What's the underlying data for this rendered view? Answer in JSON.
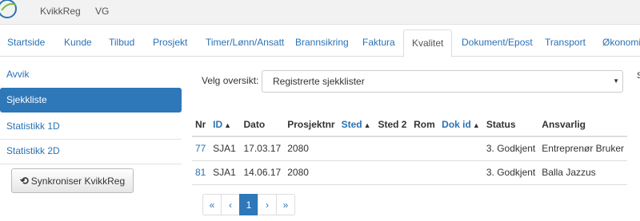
{
  "header": {
    "brand": "KvikkReg",
    "user": "VG"
  },
  "tabs": [
    {
      "label": "Startside"
    },
    {
      "label": "Kunde"
    },
    {
      "label": "Tilbud"
    },
    {
      "label": "Prosjekt"
    },
    {
      "label": "Timer/Lønn/Ansatt"
    },
    {
      "label": "Brannsikring"
    },
    {
      "label": "Faktura"
    },
    {
      "label": "Kvalitet"
    },
    {
      "label": "Dokument/Epost"
    },
    {
      "label": "Transport"
    },
    {
      "label": "Økonomi"
    }
  ],
  "sidebar": {
    "items": [
      {
        "label": "Avvik"
      },
      {
        "label": "Sjekkliste"
      },
      {
        "label": "Statistikk 1D"
      },
      {
        "label": "Statistikk 2D"
      }
    ],
    "sync_button": "Synkroniser KvikkReg"
  },
  "overview": {
    "label": "Velg oversikt:",
    "selected": "Registrerte sjekklister",
    "edge_text": "S"
  },
  "table": {
    "columns": [
      "Nr",
      "ID",
      "Dato",
      "Prosjektnr",
      "Sted",
      "Sted 2",
      "Rom",
      "Dok id",
      "Status",
      "Ansvarlig"
    ],
    "rows": [
      {
        "nr": "77",
        "id": "SJA1",
        "dato": "17.03.17",
        "prosjektnr": "2080",
        "sted": "",
        "sted2": "",
        "rom": "",
        "dokid": "",
        "status": "3. Godkjent",
        "ansvarlig": "Entreprenør Bruker"
      },
      {
        "nr": "81",
        "id": "SJA1",
        "dato": "14.06.17",
        "prosjektnr": "2080",
        "sted": "",
        "sted2": "",
        "rom": "",
        "dokid": "",
        "status": "3. Godkjent",
        "ansvarlig": "Balla Jazzus"
      }
    ]
  },
  "pagination": {
    "first": "«",
    "prev": "‹",
    "current": "1",
    "next": "›",
    "last": "»"
  },
  "colors": {
    "accent": "#2e77b9",
    "link": "#2a72b5"
  }
}
